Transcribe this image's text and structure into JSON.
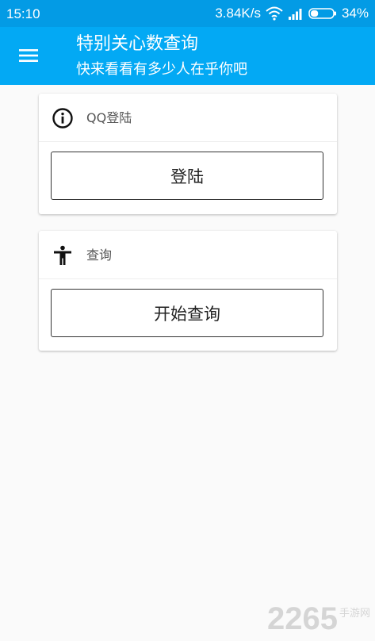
{
  "status_bar": {
    "time": "15:10",
    "network_speed": "3.84K/s",
    "battery": "34%",
    "battery_level_percent": 34
  },
  "toolbar": {
    "title": "特别关心数查询",
    "subtitle": "快来看看有多少人在乎你吧",
    "menu_icon": "hamburger-menu-icon"
  },
  "cards": [
    {
      "icon": "info-icon",
      "label": "QQ登陆",
      "button_label": "登陆"
    },
    {
      "icon": "accessibility-person-icon",
      "label": "查询",
      "button_label": "开始查询"
    }
  ],
  "watermark": {
    "number": "2265",
    "text": "手游网"
  },
  "colors": {
    "status_bar": "#039be5",
    "toolbar": "#03a9f4",
    "background": "#fafafa",
    "card": "#ffffff"
  }
}
